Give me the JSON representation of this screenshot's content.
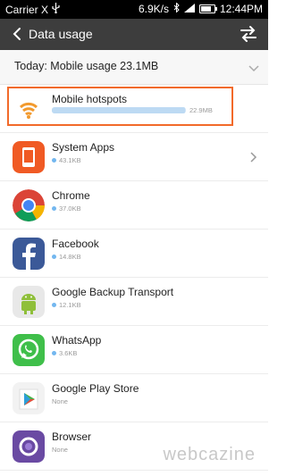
{
  "status_bar": {
    "carrier": "Carrier X",
    "speed": "6.9K/s",
    "time": "12:44PM",
    "battery_level": 0.8
  },
  "header": {
    "title": "Data usage",
    "back_icon": "arrow-left-icon",
    "swap_icon": "swap-icon"
  },
  "summary": {
    "text": "Today: Mobile usage 23.1MB"
  },
  "apps": [
    {
      "name": "Mobile hotspots",
      "usage": "22.9MB",
      "usage_fraction": 0.99,
      "icon": "wifi-icon",
      "highlighted": true
    },
    {
      "name": "System Apps",
      "usage": "43.1KB",
      "icon": "system-apps-icon"
    },
    {
      "name": "Chrome",
      "usage": "37.0KB",
      "icon": "chrome-icon"
    },
    {
      "name": "Facebook",
      "usage": "14.8KB",
      "icon": "facebook-icon"
    },
    {
      "name": "Google Backup Transport",
      "usage": "12.1KB",
      "icon": "android-icon"
    },
    {
      "name": "WhatsApp",
      "usage": "3.6KB",
      "icon": "whatsapp-icon"
    },
    {
      "name": "Google Play Store",
      "usage": "None",
      "icon": "play-store-icon"
    },
    {
      "name": "Browser",
      "usage": "None",
      "icon": "browser-icon"
    }
  ],
  "watermark": "webcazine",
  "colors": {
    "accent": "#f26a2a",
    "header_bg": "#3d3d3d",
    "bar": "#cfe4f7"
  }
}
